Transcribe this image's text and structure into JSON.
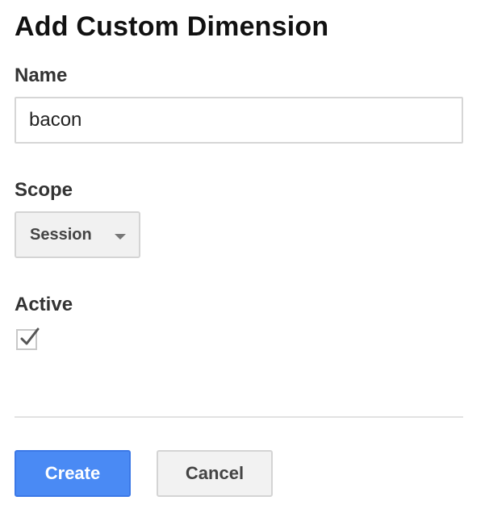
{
  "dialog": {
    "title": "Add Custom Dimension"
  },
  "name_field": {
    "label": "Name",
    "value": "bacon"
  },
  "scope_field": {
    "label": "Scope",
    "selected": "Session"
  },
  "active_field": {
    "label": "Active",
    "checked": true
  },
  "actions": {
    "create_label": "Create",
    "cancel_label": "Cancel"
  },
  "colors": {
    "primary": "#4a8af4",
    "secondary": "#f2f2f2"
  }
}
